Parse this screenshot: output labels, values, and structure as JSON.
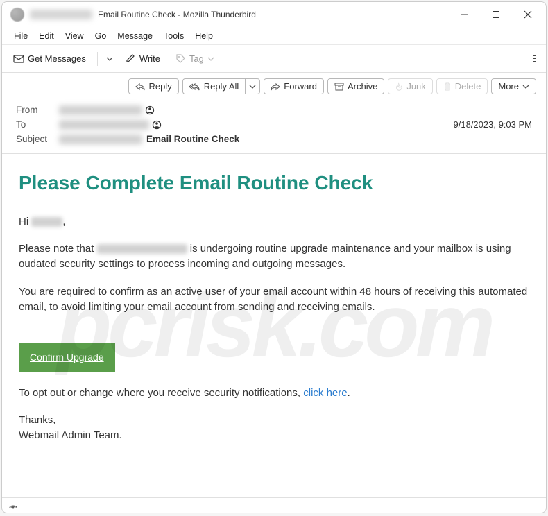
{
  "window": {
    "title_suffix": "Email Routine Check - Mozilla Thunderbird"
  },
  "menubar": {
    "file": "File",
    "edit": "Edit",
    "view": "View",
    "go": "Go",
    "message": "Message",
    "tools": "Tools",
    "help": "Help"
  },
  "toolbar": {
    "get_messages": "Get Messages",
    "write": "Write",
    "tag": "Tag"
  },
  "actions": {
    "reply": "Reply",
    "reply_all": "Reply All",
    "forward": "Forward",
    "archive": "Archive",
    "junk": "Junk",
    "delete": "Delete",
    "more": "More"
  },
  "headers": {
    "from_label": "From",
    "to_label": "To",
    "subject_label": "Subject",
    "subject_text": "Email Routine Check",
    "date": "9/18/2023, 9:03 PM"
  },
  "body": {
    "heading": "Please Complete Email Routine Check",
    "greeting_prefix": "Hi ",
    "greeting_suffix": ",",
    "p1_a": "Please note that ",
    "p1_b": " is undergoing routine upgrade maintenance and your mailbox  is using oudated security settings to process incoming and outgoing messages.",
    "p2": "You are required to confirm as an active user of your email account within 48 hours of receiving this automated email, to avoid limiting your email account  from sending and receiving emails.",
    "confirm": "Confirm Upgrade",
    "optout_a": "To opt out or change where you receive security notifications,    ",
    "optout_link": "click here",
    "optout_b": ".",
    "thanks": "Thanks,",
    "team": "Webmail Admin Team."
  },
  "status": {
    "icon": "((○))"
  }
}
